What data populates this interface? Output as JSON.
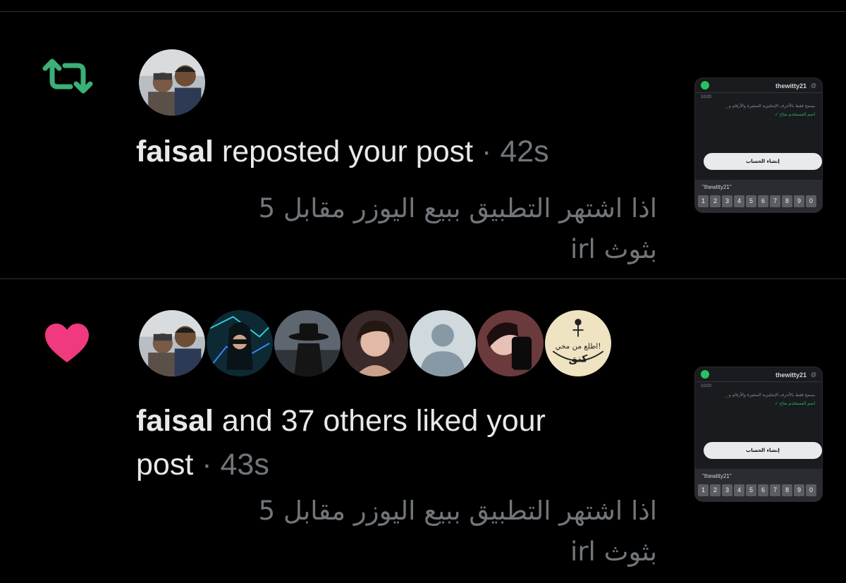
{
  "colors": {
    "background": "#000000",
    "divider": "#2f3336",
    "primary_text": "#e7e9ea",
    "secondary_text": "#71767b",
    "repost_icon": "#3bb077",
    "like_icon": "#f0397e"
  },
  "notifications": [
    {
      "type": "repost",
      "icon": "repost-icon",
      "actor": "faisal",
      "action": "reposted your post",
      "separator": "·",
      "time": "42s",
      "post_text_line1": "اذا اشتهر التطبيق ببيع اليوزر مقابل 5",
      "post_text_line2": "بثوث irl",
      "thumbnail": {
        "username": "thewitty21",
        "at": "@",
        "count": "10/20",
        "help": "يسمح فقط بالأحرف الإنجليزية الصغيرة والأرقام و _",
        "available": "اسم المستخدم متاح ✓",
        "button": "إنشاء الحساب",
        "suggestion": "\"thewitty21\"",
        "digits": [
          "1",
          "2",
          "3",
          "4",
          "5",
          "6",
          "7",
          "8",
          "9",
          "0"
        ]
      }
    },
    {
      "type": "like",
      "icon": "heart-icon",
      "actor": "faisal",
      "action": "and 37 others liked your",
      "action_line2": "post",
      "separator": "·",
      "time": "43s",
      "post_text_line1": "اذا اشتهر التطبيق ببيع اليوزر مقابل 5",
      "post_text_line2": "بثوث irl",
      "avatar_badge_text": "اطلع من مخي!",
      "avatar_badge_word": "كنق",
      "thumbnail": {
        "username": "thewitty21",
        "at": "@",
        "count": "10/20",
        "help": "يسمح فقط بالأحرف الإنجليزية الصغيرة والأرقام و _",
        "available": "اسم المستخدم متاح ✓",
        "button": "إنشاء الحساب",
        "suggestion": "\"thewitty21\"",
        "digits": [
          "1",
          "2",
          "3",
          "4",
          "5",
          "6",
          "7",
          "8",
          "9",
          "0"
        ]
      }
    }
  ]
}
